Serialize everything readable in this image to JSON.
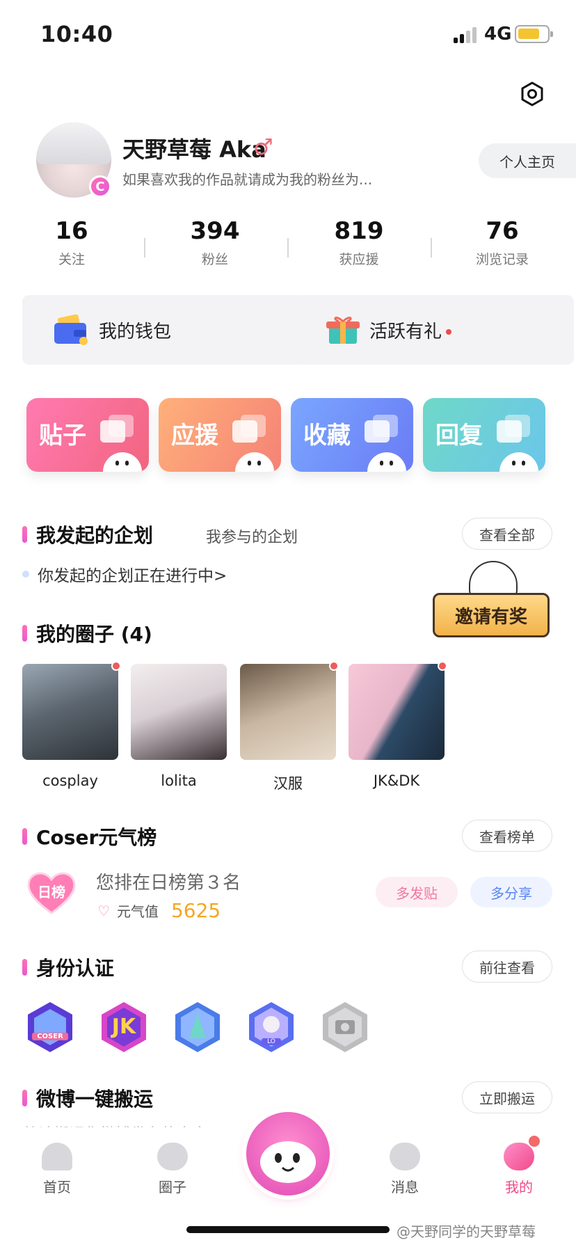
{
  "status_bar": {
    "time": "10:40",
    "network": "4G"
  },
  "profile": {
    "username": "天野草莓 Aka",
    "gender_symbol": "♂",
    "bio": "如果喜欢我的作品就请成为我的粉丝为...",
    "badge_letter": "C",
    "homepage_button": "个人主页"
  },
  "stats": [
    {
      "value": "16",
      "label": "关注"
    },
    {
      "value": "394",
      "label": "粉丝"
    },
    {
      "value": "819",
      "label": "获应援"
    },
    {
      "value": "76",
      "label": "浏览记录"
    }
  ],
  "quick_actions": {
    "wallet": "我的钱包",
    "activity": "活跃有礼"
  },
  "tiles": [
    {
      "label": "贴子",
      "icon": "post-icon"
    },
    {
      "label": "应援",
      "icon": "support-icon"
    },
    {
      "label": "收藏",
      "icon": "favorite-icon"
    },
    {
      "label": "回复",
      "icon": "reply-icon"
    }
  ],
  "plans": {
    "tab_mine": "我发起的企划",
    "tab_joined": "我参与的企划",
    "view_all": "查看全部",
    "status_text": "你发起的企划正在进行中>"
  },
  "invite": {
    "label": "邀请有奖"
  },
  "circles": {
    "title": "我的圈子 (4)",
    "items": [
      {
        "name": "cosplay",
        "has_dot": true
      },
      {
        "name": "lolita",
        "has_dot": false
      },
      {
        "name": "汉服",
        "has_dot": true
      },
      {
        "name": "JK&DK",
        "has_dot": true
      }
    ]
  },
  "ranking": {
    "title": "Coser元气榜",
    "view_button": "查看榜单",
    "heart_label": "日榜",
    "rank_text": "您排在日榜第３名",
    "energy_label": "元气值",
    "energy_value": "5625",
    "post_more": "多发贴",
    "share_more": "多分享"
  },
  "identity": {
    "title": "身份认证",
    "go_button": "前往查看",
    "badges": [
      "COSER",
      "JK",
      "",
      "LO",
      ""
    ]
  },
  "weibo": {
    "title": "微博一键搬运",
    "button": "立即搬运",
    "subtitle": "快速搬运你微博发布的内容"
  },
  "bottom_nav": [
    {
      "label": "首页",
      "icon": "ghost-icon"
    },
    {
      "label": "圈子",
      "icon": "planet-icon"
    },
    {
      "label": "消息",
      "icon": "message-icon"
    },
    {
      "label": "我的",
      "icon": "me-icon"
    }
  ],
  "watermark": "@天野同学的天野草莓",
  "colors": {
    "accent": "#f04a8a",
    "energy": "#f5a623"
  }
}
